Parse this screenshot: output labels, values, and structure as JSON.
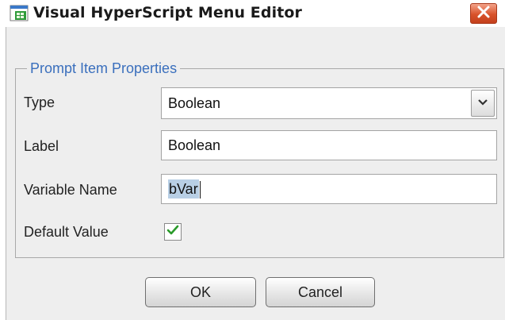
{
  "window": {
    "title": "Visual HyperScript Menu Editor",
    "icon": "app-window-icon",
    "close_icon": "close-x-icon"
  },
  "group": {
    "legend": "Prompt Item Properties"
  },
  "fields": {
    "type": {
      "label": "Type",
      "value": "Boolean"
    },
    "label": {
      "label": "Label",
      "value": "Boolean"
    },
    "variable_name": {
      "label": "Variable Name",
      "value": "bVar"
    },
    "default_value": {
      "label": "Default Value",
      "checked": true
    }
  },
  "buttons": {
    "ok": "OK",
    "cancel": "Cancel"
  },
  "colors": {
    "legend": "#3a6fbd",
    "close_button": "#d9532b",
    "checkmark": "#2a9a2a",
    "selection": "#b8cfe5"
  }
}
